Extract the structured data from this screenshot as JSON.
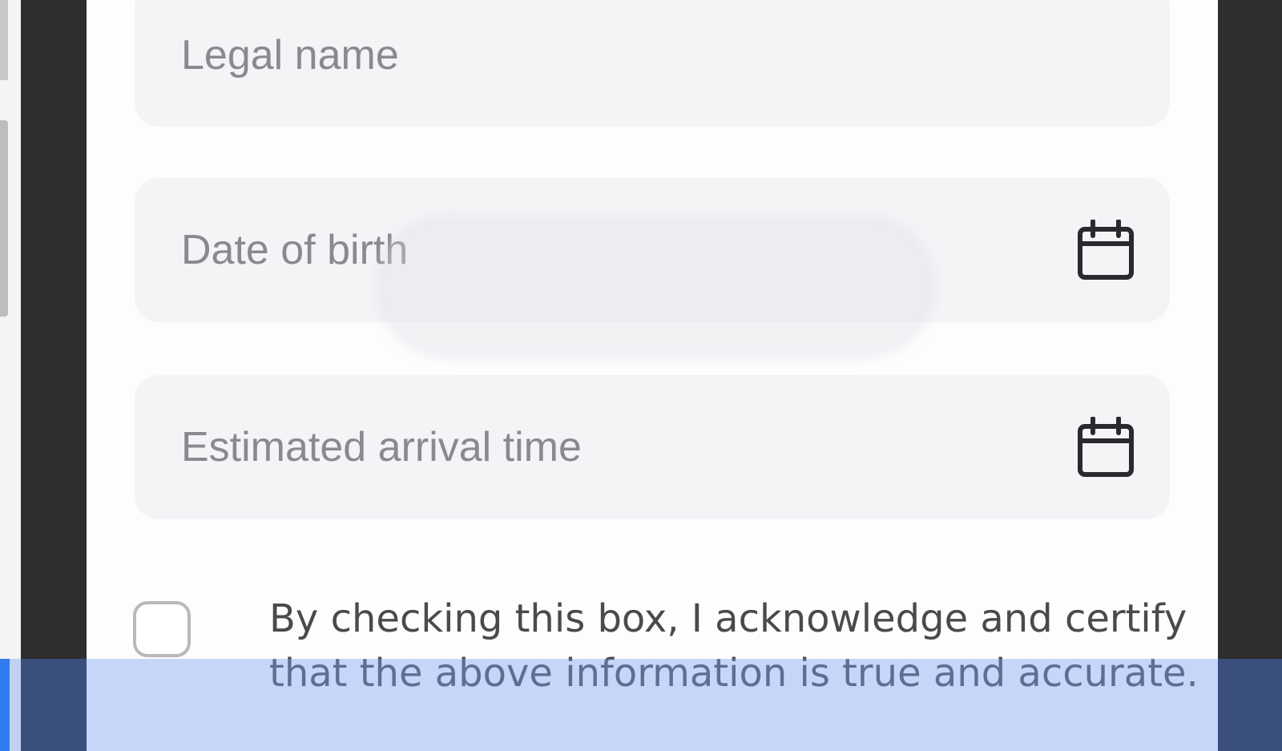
{
  "form": {
    "legal_name": {
      "placeholder": "Legal name",
      "value": ""
    },
    "date_of_birth": {
      "placeholder": "Date of birth",
      "value": "",
      "icon": "calendar-icon"
    },
    "estimated_arrival": {
      "placeholder": "Estimated arrival time",
      "value": "",
      "icon": "calendar-icon"
    },
    "consent": {
      "checked": false,
      "text": "By checking this box, I acknowledge and certify that the above information is true and accurate."
    }
  },
  "colors": {
    "field_bg": "#f4f4f7",
    "placeholder": "#8a8a8e",
    "text": "#4a4a4e",
    "frame": "#2e2e2e",
    "highlight": "#78a0f0"
  }
}
